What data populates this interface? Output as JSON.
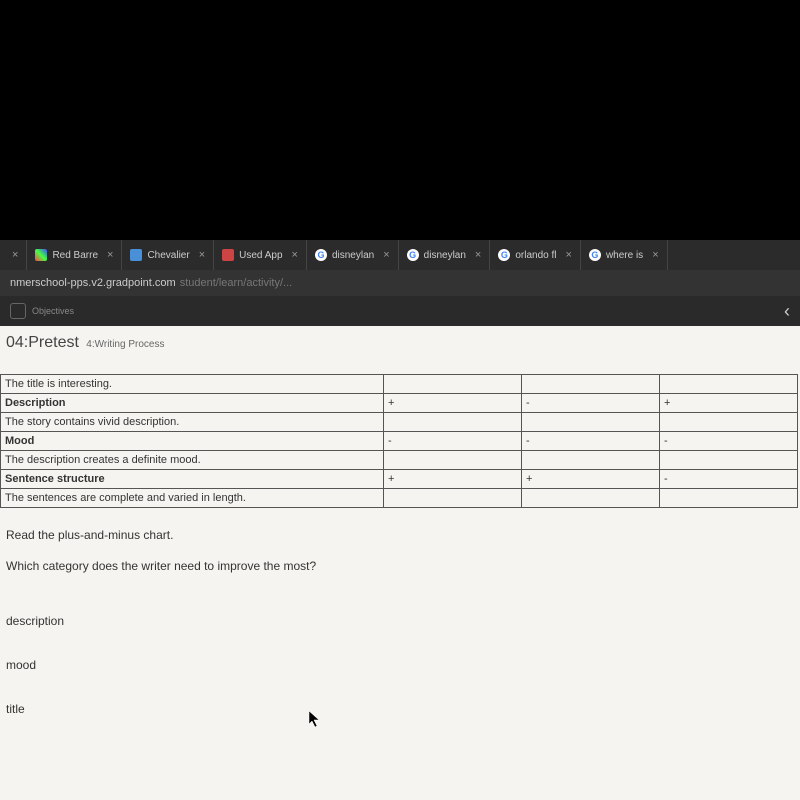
{
  "tabs": [
    {
      "label": "",
      "icon": "plain"
    },
    {
      "label": "Red Barre",
      "icon": "colorful"
    },
    {
      "label": "Chevalier",
      "icon": "blue"
    },
    {
      "label": "Used App",
      "icon": "red"
    },
    {
      "label": "disneylan",
      "icon": "google"
    },
    {
      "label": "disneylan",
      "icon": "google"
    },
    {
      "label": "orlando fl",
      "icon": "google"
    },
    {
      "label": "where is",
      "icon": "google"
    }
  ],
  "url": {
    "main": "nmerschool-pps.v2.gradpoint.com",
    "rest": "student/learn/activity/..."
  },
  "toolbar": {
    "label": "Objectives"
  },
  "page": {
    "title": "04:Pretest",
    "subtitle": "4:Writing Process"
  },
  "rubric": {
    "r1": "The title is interesting.",
    "r2_label": "Description",
    "r2_c1": "+",
    "r2_c2": "-",
    "r2_c3": "+",
    "r3": "The story contains vivid description.",
    "r4_label": "Mood",
    "r4_c1": "-",
    "r4_c2": "-",
    "r4_c3": "-",
    "r5": "The description creates a definite mood.",
    "r6_label": "Sentence structure",
    "r6_c1": "+",
    "r6_c2": "+",
    "r6_c3": "-",
    "r7": "The sentences are complete and varied in length."
  },
  "question": {
    "line1": "Read the plus-and-minus chart.",
    "line2": "Which category does the writer need to improve the most?"
  },
  "options": {
    "o1": "description",
    "o2": "mood",
    "o3": "title"
  }
}
